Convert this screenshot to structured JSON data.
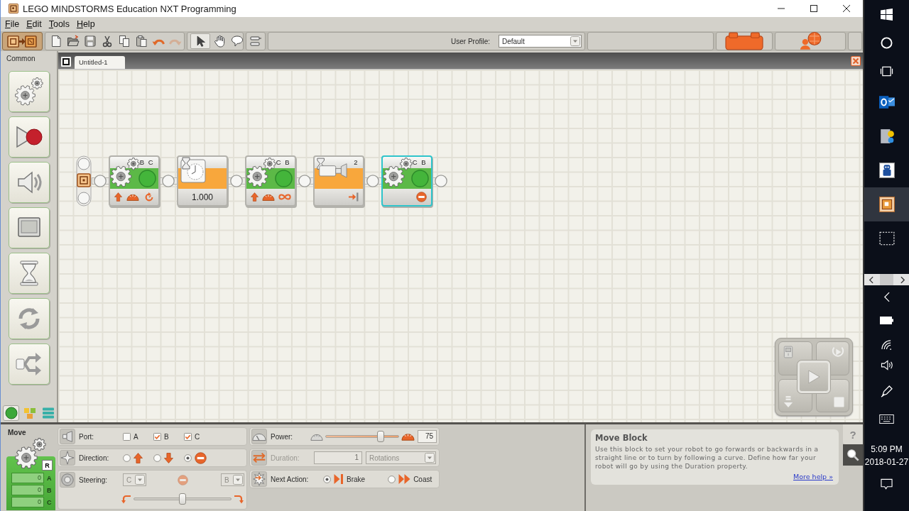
{
  "window": {
    "title": "LEGO MINDSTORMS Education NXT Programming"
  },
  "menu": [
    "File",
    "Edit",
    "Tools",
    "Help"
  ],
  "toolbar": {
    "undo_redo": [
      {
        "disabled": false
      },
      {
        "disabled": true
      }
    ],
    "tools": [
      {
        "selected": true
      },
      {
        "selected": false
      },
      {
        "selected": false
      }
    ],
    "user_profile": {
      "label": "User Profile:",
      "value": "Default"
    }
  },
  "palette": {
    "title": "Common",
    "tabs": [
      {
        "selected": true
      },
      {
        "selected": false
      },
      {
        "selected": false
      }
    ]
  },
  "document_tabs": [
    {
      "label": "Untitled-1",
      "selected": true
    }
  ],
  "program": {
    "blocks": [
      {
        "kind": "move",
        "ports": "B C",
        "settings": [
          {
            "kind": "forward"
          },
          {
            "kind": "power"
          },
          {
            "kind": "rotations"
          }
        ],
        "selected": false
      },
      {
        "kind": "wait_time",
        "value": "1.000",
        "selected": false
      },
      {
        "kind": "move",
        "ports": "C B",
        "settings": [
          {
            "kind": "forward"
          },
          {
            "kind": "power"
          },
          {
            "kind": "unlimited"
          }
        ],
        "selected": false
      },
      {
        "kind": "wait_sensor",
        "port": "2",
        "selected": false
      },
      {
        "kind": "move",
        "ports": "C B",
        "settings": [
          {
            "kind": "stop"
          }
        ],
        "selected": true
      }
    ]
  },
  "config": {
    "title": "Move",
    "reset": "R",
    "counters": [
      {
        "value": "0",
        "port": "A"
      },
      {
        "value": "0",
        "port": "B"
      },
      {
        "value": "0",
        "port": "C"
      }
    ],
    "port": {
      "label": "Port:",
      "options": [
        {
          "label": "A",
          "checked": false
        },
        {
          "label": "B",
          "checked": true
        },
        {
          "label": "C",
          "checked": true
        }
      ]
    },
    "direction": {
      "label": "Direction:",
      "options": [
        {
          "kind": "forward",
          "selected": false
        },
        {
          "kind": "backward",
          "selected": false
        },
        {
          "kind": "stop",
          "selected": true
        }
      ]
    },
    "steering": {
      "label": "Steering:",
      "left": "C",
      "right": "B",
      "disabled": true,
      "level": 0.5
    },
    "power": {
      "label": "Power:",
      "level": 0.75,
      "value": "75"
    },
    "duration": {
      "label": "Duration:",
      "value": "1",
      "unit": "Rotations",
      "disabled": true
    },
    "next_action": {
      "label": "Next Action:",
      "options": [
        {
          "kind": "brake",
          "label": "Brake",
          "selected": true
        },
        {
          "kind": "coast",
          "label": "Coast",
          "selected": false
        }
      ]
    }
  },
  "help": {
    "title": "Move Block",
    "text": "Use this block to set your robot to go forwards or backwards in a straight line or to turn by following a curve. Define how far your robot will go by using the Duration property.",
    "link": "More help »",
    "help_button": "?"
  },
  "taskbar": {
    "apps": [
      {
        "selected": false
      },
      {
        "selected": false
      },
      {
        "selected": false
      },
      {
        "selected": true
      },
      {
        "selected": false
      }
    ],
    "time": "5:09 PM",
    "date": "2018-01-27"
  }
}
